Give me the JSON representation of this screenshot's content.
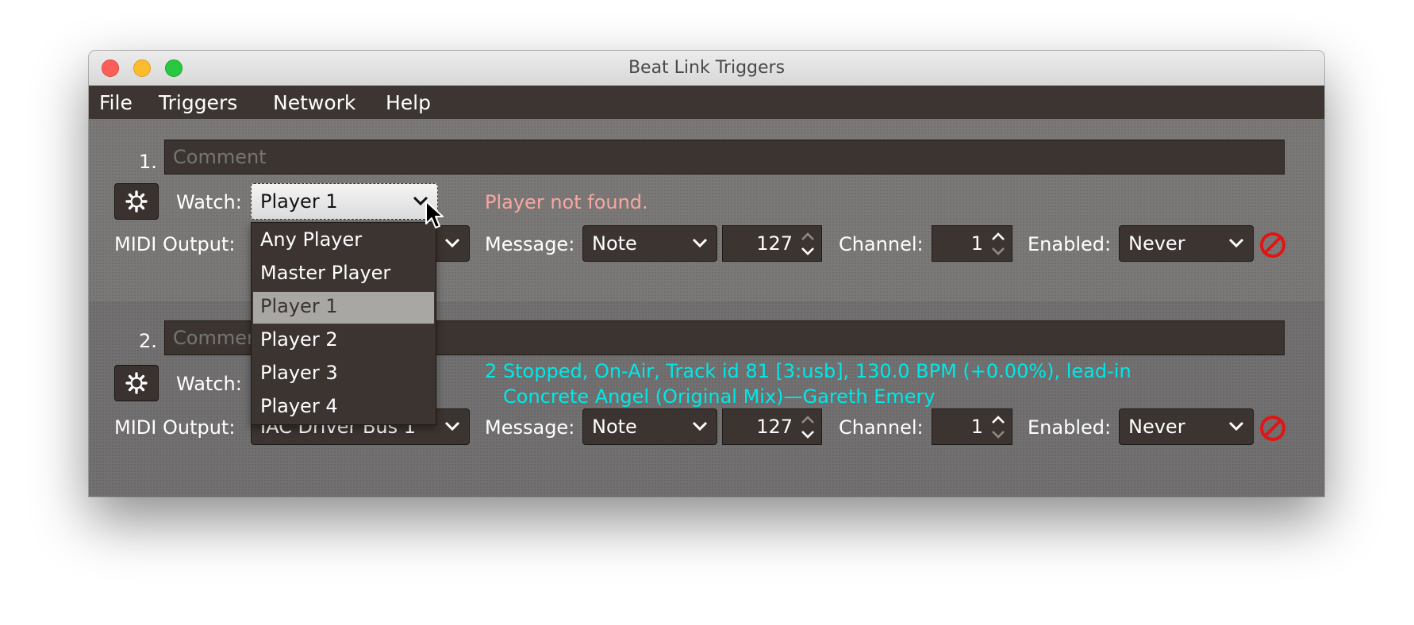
{
  "window": {
    "title": "Beat Link Triggers"
  },
  "menu": [
    "File",
    "Triggers",
    "Network",
    "Help"
  ],
  "triggers": [
    {
      "number": "1.",
      "comment_placeholder": "Comment",
      "watch_label": "Watch:",
      "watch_value": "Player 1",
      "status": "Player not found.",
      "midi_output_label": "MIDI Output:",
      "midi_output_value": "",
      "message_label": "Message:",
      "message_value": "Note",
      "note_value": "127",
      "channel_label": "Channel:",
      "channel_value": "1",
      "enabled_label": "Enabled:",
      "enabled_value": "Never"
    },
    {
      "number": "2.",
      "comment_placeholder": "Comment",
      "watch_label": "Watch:",
      "status_line1": "2 Stopped, On-Air, Track id 81 [3:usb], 130.0 BPM (+0.00%), lead-in",
      "status_line2": "Concrete Angel (Original Mix)—Gareth Emery",
      "midi_output_label": "MIDI Output:",
      "midi_output_value": "IAC Driver Bus 1",
      "message_label": "Message:",
      "message_value": "Note",
      "note_value": "127",
      "channel_label": "Channel:",
      "channel_value": "1",
      "enabled_label": "Enabled:",
      "enabled_value": "Never"
    }
  ],
  "watch_dropdown": {
    "options": [
      "Any Player",
      "Master Player",
      "Player 1",
      "Player 2",
      "Player 3",
      "Player 4"
    ],
    "selected": "Player 1"
  },
  "colors": {
    "status_error": "#f7a7a2",
    "status_info": "#00e8e8",
    "disabled_icon": "#e01515",
    "panel_bg": "#7b7977",
    "control_bg": "#3c3430"
  },
  "icons": [
    "gear-icon",
    "chevron-down-icon",
    "spinner-arrows-icon",
    "disabled-icon",
    "mouse-cursor-icon"
  ]
}
